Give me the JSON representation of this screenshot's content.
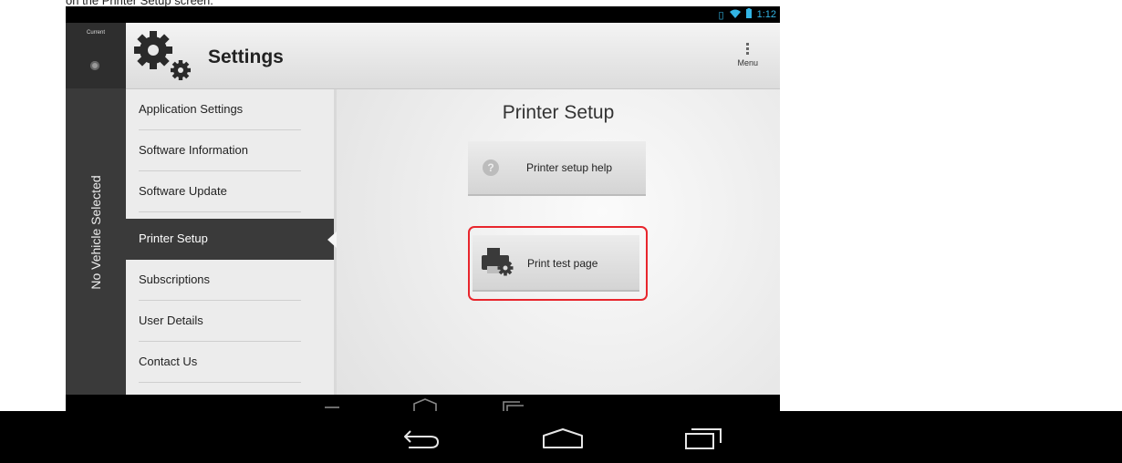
{
  "caption": "on the Printer Setup screen.",
  "status_bar": {
    "time": "1:12"
  },
  "left_rail": {
    "current_label": "Current",
    "vehicle_label": "No Vehicle Selected"
  },
  "header": {
    "title": "Settings",
    "menu_label": "Menu"
  },
  "nav": {
    "items": [
      {
        "label": "Application Settings"
      },
      {
        "label": "Software Information"
      },
      {
        "label": "Software Update"
      },
      {
        "label": "Printer Setup"
      },
      {
        "label": "Subscriptions"
      },
      {
        "label": "User Details"
      },
      {
        "label": "Contact Us"
      }
    ],
    "active_index": 3
  },
  "content": {
    "title": "Printer Setup",
    "help_button_label": "Printer setup help",
    "help_icon_glyph": "?",
    "print_button_label": "Print test page"
  },
  "colors": {
    "accent": "#33b5e5",
    "highlight": "#e8262d",
    "active_nav": "#3a3a3a"
  },
  "icons": [
    "gear-icon",
    "menu-icon",
    "help-icon",
    "printer-icon",
    "back-icon",
    "home-icon",
    "recent-apps-icon",
    "battery-icon",
    "wifi-icon",
    "signal-icon"
  ]
}
